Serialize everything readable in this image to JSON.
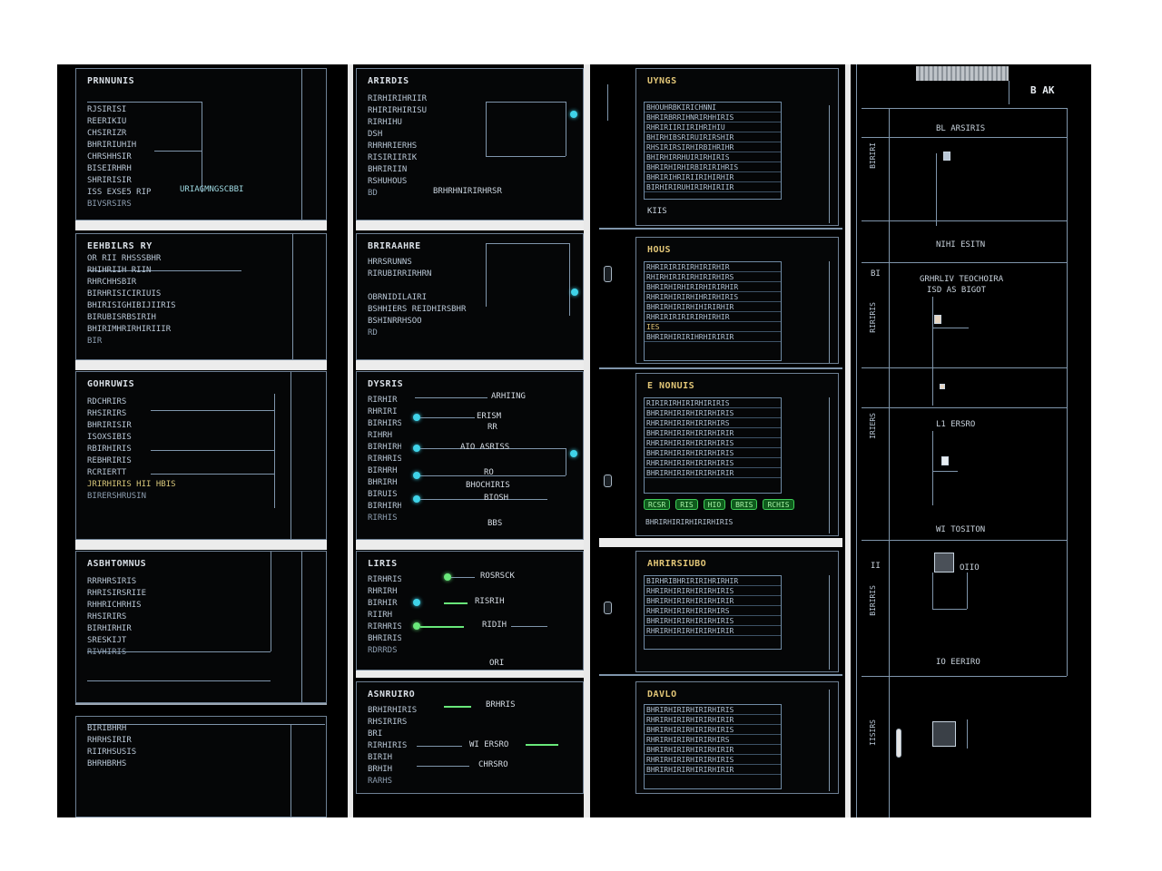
{
  "columns": [
    {
      "id": "col1",
      "panels": [
        {
          "title": "PRNNUNIS",
          "rows": [
            "RJSIRISI",
            "REERIKIU",
            "CHSIRIZR",
            "BHRIRIUHIH",
            "CHRSHHSIR",
            "BISEIRHRH",
            "SHRIRISIR",
            "ISS EXSE5 RIP",
            "BIVSRSIRS"
          ],
          "note": "URIAGMNGSCBBI"
        },
        {
          "title": "EEHBILRS RY",
          "rows": [
            "OR RII RHSSSBHR",
            "RHIHRIIH RIIN",
            "RHRCHHSBIR",
            "BIRHRISICIRIUIS",
            "BHIRISIGHIBIJIIRIS",
            "BIRUBISRBSIRIH",
            "BHIRIMHRIRHIRIIIR",
            "BIR"
          ]
        },
        {
          "title": "GOHRUWIS",
          "rows": [
            "RDCHRIRS",
            "RHSIRIRS",
            "BHRIRISIR",
            "ISOXSIBIS",
            "RBIRHIRIS",
            "REBHRIRIS",
            "RCRIERTT",
            "JRIRHIRIS HII HBIS",
            "BIRERSHRUSIN"
          ]
        },
        {
          "title": "ASBHTOMNUS",
          "rows": [
            "RRRHRSIRIS",
            "RHRISIRSRIIE",
            "RHHRICHRHIS",
            "RHSIRIRS",
            "BIRHIRHIR",
            "SRESKIJT",
            "RIVHIRIS"
          ]
        },
        {
          "title": "",
          "rows": [
            "BIRIBHRH",
            "RHRHSIRIR",
            "RIIRHSUSIS",
            "BHRHBRHS"
          ]
        }
      ]
    },
    {
      "id": "col2",
      "panels": [
        {
          "title": "ARIRDIS",
          "rows": [
            "RIRHIRIHRIIR",
            "RHIRIRHIRISU",
            "RIRHIHU",
            "DSH",
            "RHRHRIERHS",
            "RISIRIIRIK",
            "BHRIRIIN",
            "RSHUHOUS",
            "BD"
          ],
          "note": "BRHRHNIRIRHRSR"
        },
        {
          "title": "BRIRAAHRE",
          "rows": [
            "HRRSRUNNS",
            "RIRUBIRRIRHRN",
            "",
            "OBRNIDILAIRI",
            "BSHHIERS REIDHIRSBHR",
            "BSHINRRHSOO",
            "RD"
          ]
        },
        {
          "title": "DYSRIS",
          "rows": [
            "RIRHIR",
            "RHRIRI",
            "BIRHIRS",
            "RIHRH",
            "BIRHIRH",
            "RIRHRIS",
            "BIRHRH",
            "BHRIRH",
            "BIRUIS",
            "BIRHIRH",
            "RIRHIS"
          ],
          "wires": [
            {
              "label": "ARHIING"
            },
            {
              "label": "ERISM"
            },
            {
              "label": "RR"
            },
            {
              "label": "AIO ASRISS"
            },
            {
              "label": "RO"
            },
            {
              "label": "BHOCHIRIS"
            },
            {
              "label": "BIOSH"
            },
            {
              "label": "BBS"
            }
          ]
        },
        {
          "title": "LIRIS",
          "rows": [
            "RIRHRIS",
            "RHRIRH",
            "BIRHIR",
            "RIIRH",
            "RIRHRIS",
            "BHRIRIS",
            "RDRRDS"
          ],
          "wires": [
            {
              "label": "ROSRSCK"
            },
            {
              "label": "RISRIH"
            },
            {
              "label": "RIDIH"
            },
            {
              "label": "ORI"
            }
          ]
        },
        {
          "title": "ASNRUIRO",
          "rows": [
            "BRHIRHIRIS",
            "RHSIRIRS",
            "BRI",
            "RIRHIRIS",
            "BIRIH",
            "BRHIH",
            "RARHS"
          ],
          "wires": [
            {
              "label": "BRHRIS"
            },
            {
              "label": "WI ERSRO"
            },
            {
              "label": "CHRSRO"
            }
          ]
        }
      ]
    },
    {
      "id": "col3",
      "panels": [
        {
          "title": "UYNGS",
          "grid": [
            "BHOUHRBKIRICHNNI",
            "BHRIRBRRIHNRIRHHIRIS",
            "RHRIRIIRIIRIHRIHIU",
            "BHIRHIBSRIRUIRIRSHIR",
            "RHSIRIRSIRHIRBIHRIHR",
            "BHIRHIRRHUIRIRHIRIS",
            "BHRIRHIRHIRBIRIRIHRIS",
            "BHRIRIHRIRIIRIHIRHIR",
            "BIRHIRIRUHIRIRHIRIIR"
          ],
          "note": "KIIS"
        },
        {
          "title": "HOUS",
          "grid": [
            "RHRIRIRIRIRHIRIRHIR",
            "RHIRHIRIRIRHIRIRHIRS",
            "BHRIRHIRHIRIRHIRIRHIR",
            "RHRIRHIRIRHIHRIRHIRIS",
            "BHRIRHIRIRHIHIRIRHIR",
            "RHRIRIRIRIRIRHIRHIR",
            "IES",
            "BHRIRHIRIRIHRHIRIRIR"
          ]
        },
        {
          "title": "E NONUIS",
          "grid": [
            "RIRIRIRHIRIRHIRIRIS",
            "BHRIRHIRIRHIRIRHIRIS",
            "RHRIRHIRIRHIRIRHIRS",
            "BHRIRHIRIRHIRIRHIRIR",
            "RHRIRHIRIRHIRIRHIRIS",
            "BHRIRHIRIRHIRIRHIRIS",
            "RHRIRHIRIRHIRIRHIRIS",
            "BHRIRHIRIRHIRIRHIRIR"
          ],
          "status": [
            "RCSR",
            "RIS",
            "HIO",
            "BRIS",
            "RCHIS"
          ],
          "tail": "BHRIRHIRIRHIRIRHIRIS"
        },
        {
          "title": "AHRIRSIUBO",
          "grid": [
            "BIRHRIBHRIRIRIHRIRHIR",
            "RHRIRHIRIRHIRIRHIRIS",
            "BHRIRHIRIRHIRIRHIRIR",
            "RHRIRHIRIRHIRIRHIRS",
            "BHRIRHIRIRHIRIRHIRIS",
            "RHRIRHIRIRHIRIRHIRIR"
          ]
        },
        {
          "title": "DAVLO",
          "grid": [
            "BHRIRHIRIRHIRIRHIRIS",
            "RHRIRHIRIRHIRIRHIRIR",
            "BHRIRHIRIRHIRIRHIRIS",
            "RHRIRHIRIRHIRIRHIRS",
            "BHRIRHIRIRHIRIRHIRIR",
            "RHRIRHIRIRHIRIRHIRIS",
            "BHRIRHIRIRHIRIRHIRIR"
          ]
        }
      ]
    },
    {
      "id": "col4",
      "header": "B AK",
      "labels": [
        "BL ARSIRIS",
        "NIHI ESITN",
        "GRHRLIV TEOCHOIRA",
        "ISD AS BIGOT",
        "L1 ERSRO",
        "WI TOSITON",
        "OIIO",
        "IO EERIRO"
      ],
      "side": [
        "BIRIRI",
        "RIRIRIS",
        "IRIERS",
        "BIRIRIS",
        "IISIRS",
        "RIRIS"
      ],
      "small": [
        "BI",
        "II"
      ]
    }
  ]
}
